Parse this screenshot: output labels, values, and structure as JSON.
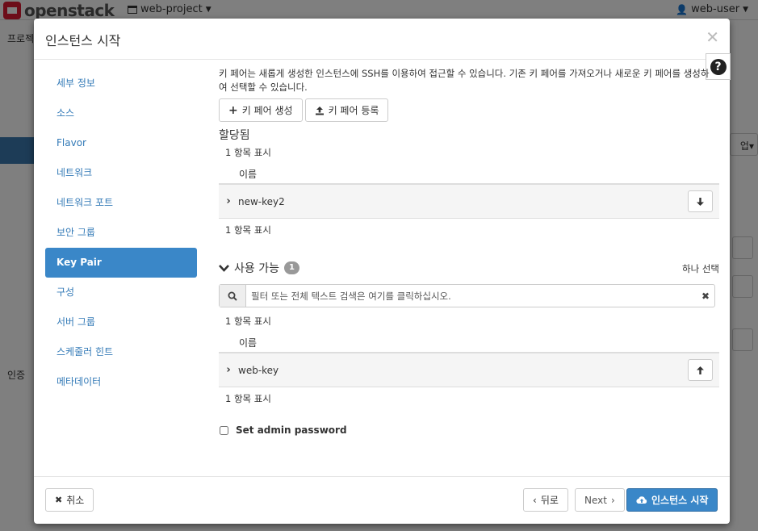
{
  "topbar": {
    "logo_text": "openstack",
    "project": "web-project",
    "user": "web-user"
  },
  "background": {
    "breadcrumb": "프로젝",
    "auth_label": "인증",
    "right_button_text": "업"
  },
  "modal": {
    "title": "인스턴스 시작",
    "help_glyph": "?"
  },
  "sidebar": {
    "items": [
      {
        "label": "세부 정보"
      },
      {
        "label": "소스"
      },
      {
        "label": "Flavor"
      },
      {
        "label": "네트워크"
      },
      {
        "label": "네트워크 포트"
      },
      {
        "label": "보안 그룹"
      },
      {
        "label": "Key Pair"
      },
      {
        "label": "구성"
      },
      {
        "label": "서버 그룹"
      },
      {
        "label": "스케줄러 힌트"
      },
      {
        "label": "메타데이터"
      }
    ],
    "active_index": 6
  },
  "content": {
    "help_text": "키 페어는 새롭게 생성한 인스턴스에 SSH를 이용하여 접근할 수 있습니다. 기존 키 페어를 가져오거나 새로운 키 페어를 생성하여 선택할 수 있습니다.",
    "create_keypair_label": "키 페어 생성",
    "import_keypair_label": "키 페어 등록",
    "allocated": {
      "title": "할당됨",
      "count_top": "1 항목 표시",
      "column_name": "이름",
      "rows": [
        {
          "name": "new-key2"
        }
      ],
      "count_bottom": "1 항목 표시"
    },
    "available": {
      "title": "사용 가능",
      "badge": "1",
      "select_one": "하나 선택",
      "search_placeholder": "필터 또는 전체 텍스트 검색은 여기를 클릭하십시오.",
      "count_top": "1 항목 표시",
      "column_name": "이름",
      "rows": [
        {
          "name": "web-key"
        }
      ],
      "count_bottom": "1 항목 표시"
    },
    "admin_password_label": "Set admin password"
  },
  "footer": {
    "cancel": "취소",
    "back": "뒤로",
    "next": "Next",
    "launch": "인스턴스 시작"
  },
  "colors": {
    "primary": "#3a87c8",
    "link": "#337ab7",
    "logo_red": "#da1a32"
  }
}
